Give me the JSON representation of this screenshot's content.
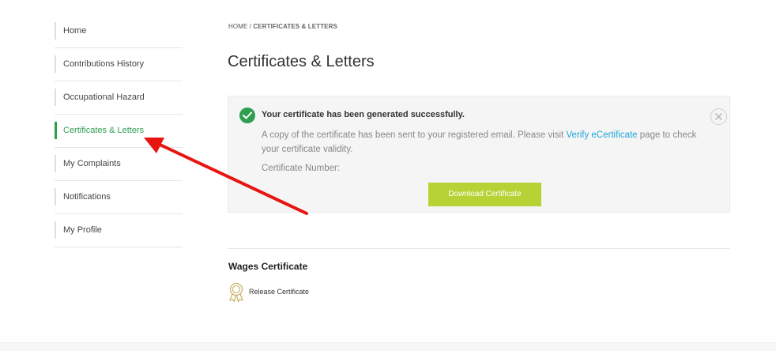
{
  "sidebar": {
    "items": [
      {
        "label": "Home"
      },
      {
        "label": "Contributions History"
      },
      {
        "label": "Occupational Hazard"
      },
      {
        "label": "Certificates & Letters",
        "active": true
      },
      {
        "label": "My Complaints"
      },
      {
        "label": "Notifications"
      },
      {
        "label": "My Profile"
      }
    ]
  },
  "breadcrumb": {
    "home": "HOME",
    "separator": "/",
    "current": "CERTIFICATES & LETTERS"
  },
  "page": {
    "title": "Certificates & Letters"
  },
  "alert": {
    "icon": "check-circle-icon",
    "title": "Your certificate has been generated successfully.",
    "message_prefix": "A copy of the certificate has been sent to your registered email. Please visit ",
    "link_text": "Verify eCertificate",
    "message_suffix": " page to check your certificate validity.",
    "certificate_number_label": "Certificate Number:",
    "download_button": "Download Certificate",
    "close_icon": "close-circle-icon"
  },
  "wages": {
    "section_title": "Wages Certificate",
    "link_label": "Release Certificate",
    "link_icon": "award-ribbon-icon"
  },
  "colors": {
    "accent_green": "#2e9e4f",
    "button_lime": "#b5d334",
    "link_blue": "#1ea7d8",
    "annotation_arrow_red": "#e8140f"
  }
}
